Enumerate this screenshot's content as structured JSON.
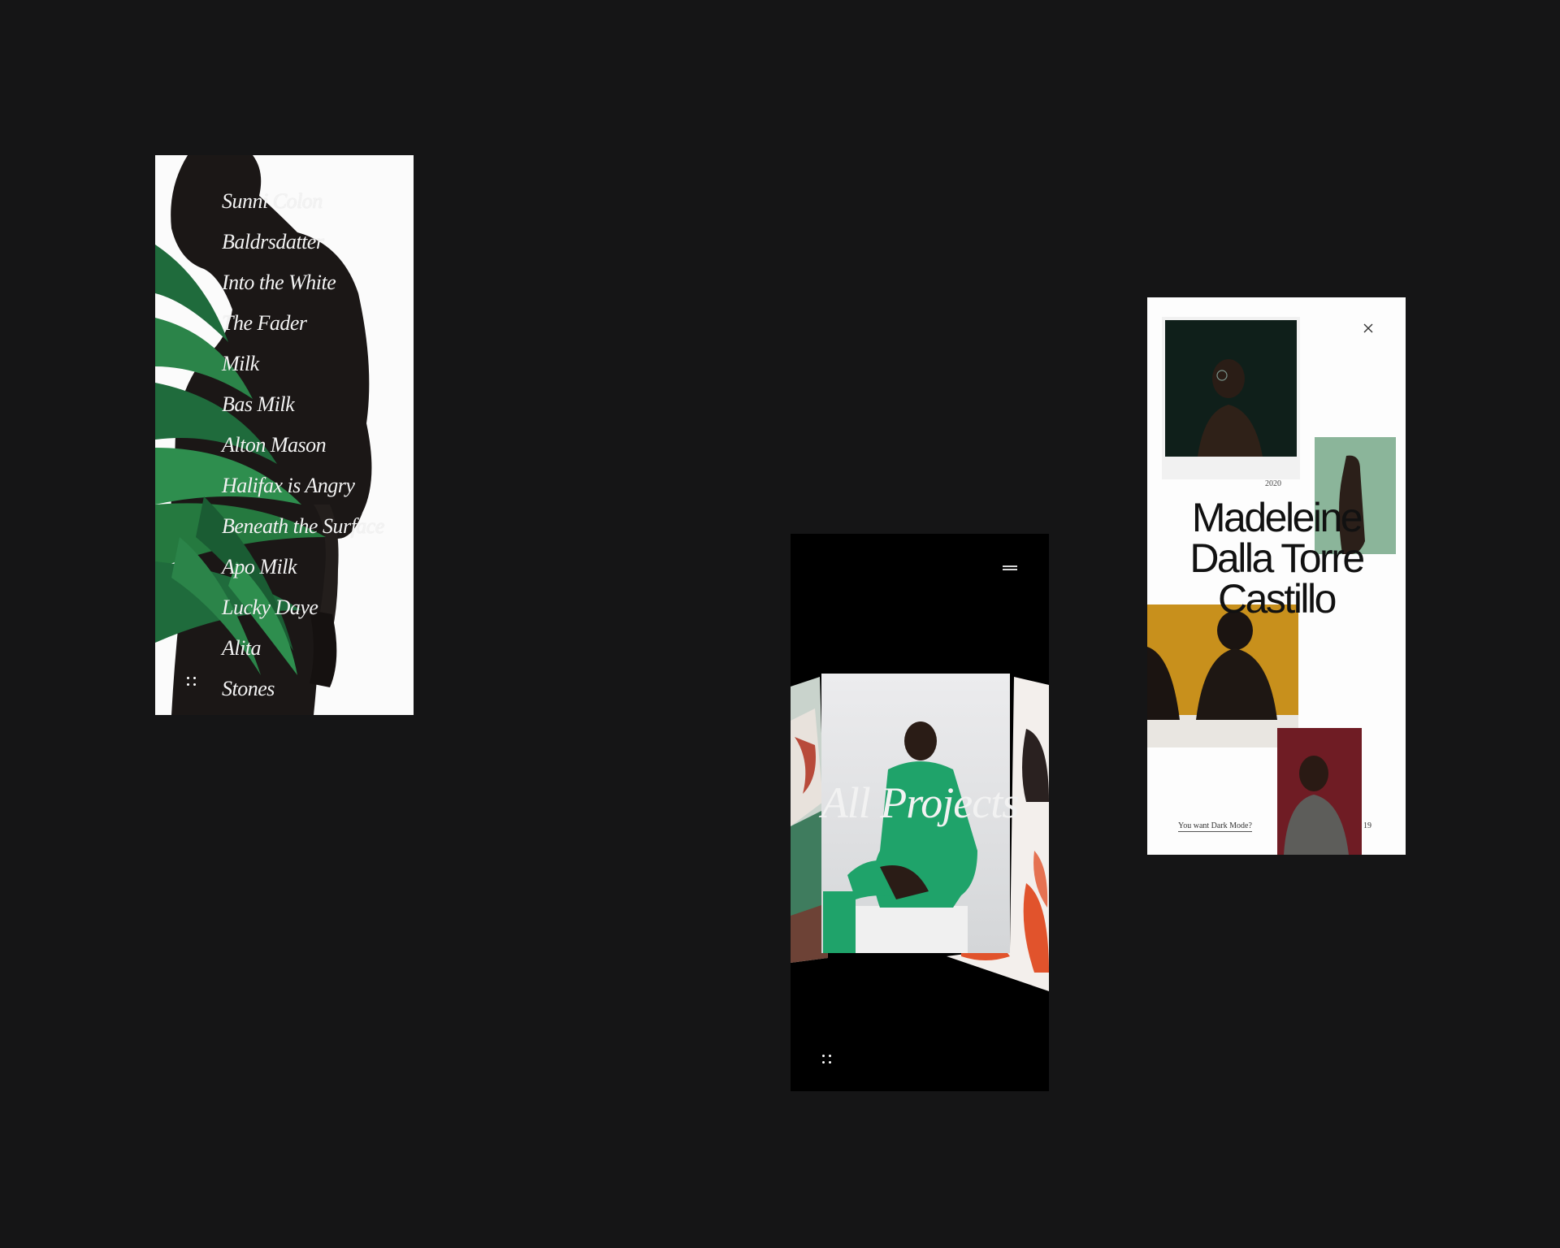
{
  "list_screen": {
    "projects": [
      "Sunni Colon",
      "Baldrsdatter",
      "Into the White",
      "The Fader",
      "Milk",
      "Bas Milk",
      "Alton Mason",
      "Halifax is Angry",
      "Beneath the Surface",
      "Apo Milk",
      "Lucky Daye",
      "Alita",
      "Stones"
    ],
    "menu_icon": "grid-dots-icon"
  },
  "projects_screen": {
    "title": "All Projects",
    "menu_icon": "hamburger-icon",
    "grid_icon": "grid-dots-icon"
  },
  "detail_screen": {
    "year": "2020",
    "name_lines": [
      "Madeleine",
      "Dalla Torre",
      "Castillo"
    ],
    "dark_mode_link": "You want Dark Mode?",
    "count": "19",
    "close_icon": "close-icon"
  },
  "colors": {
    "background": "#151516",
    "accent_green": "#1fa36a",
    "accent_mustard": "#c8901c"
  }
}
